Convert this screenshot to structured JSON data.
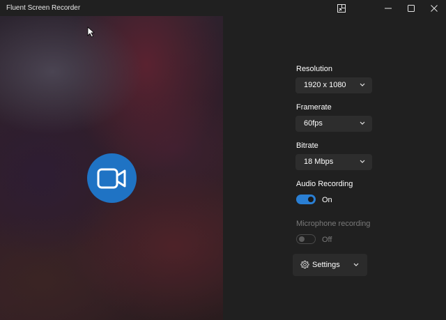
{
  "window": {
    "title": "Fluent Screen Recorder"
  },
  "panel": {
    "resolution": {
      "label": "Resolution",
      "value": "1920 x 1080"
    },
    "framerate": {
      "label": "Framerate",
      "value": "60fps"
    },
    "bitrate": {
      "label": "Bitrate",
      "value": "18 Mbps"
    },
    "audio": {
      "label": "Audio Recording",
      "state": "On"
    },
    "microphone": {
      "label": "Microphone recording",
      "state": "Off"
    },
    "settings_button": {
      "label": "Settings"
    }
  },
  "colors": {
    "accent": "#1f73c4",
    "toggle_on": "#2a7fd4",
    "panel_bg": "#202020",
    "control_bg": "#2d2d2d",
    "disabled_text": "#7a7a7a"
  },
  "icons": {
    "compact": "compact-overlay-icon",
    "minimize": "minimize-icon",
    "maximize": "maximize-icon",
    "close": "close-icon",
    "record": "video-camera-icon",
    "settings": "gear-icon",
    "dropdown": "chevron-down-icon",
    "cursor": "mouse-cursor-icon"
  }
}
